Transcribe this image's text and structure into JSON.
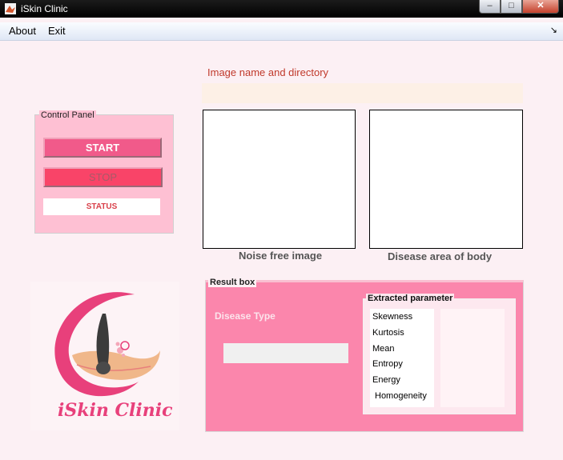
{
  "window": {
    "title": "iSkin Clinic"
  },
  "menu": {
    "items": [
      "About",
      "Exit"
    ]
  },
  "image_section": {
    "label": "Image name and directory",
    "path_value": ""
  },
  "control_panel": {
    "legend": "Control Panel",
    "start_label": "START",
    "stop_label": "STOP",
    "status_text": "STATUS"
  },
  "images": {
    "noise_caption": "Noise free image",
    "disease_caption": "Disease area of body"
  },
  "logo": {
    "text": "iSkin Clinic"
  },
  "result": {
    "legend": "Result box",
    "disease_type_label": "Disease Type",
    "disease_type_value": "",
    "params_legend": "Extracted parameter",
    "params": [
      "Skewness",
      "Kurtosis",
      "Mean",
      "Entropy",
      "Energy",
      "Homogeneity"
    ]
  },
  "colors": {
    "accent": "#f15a8a",
    "logo_pink": "#e8407b",
    "result_bg": "#fb86ac"
  }
}
